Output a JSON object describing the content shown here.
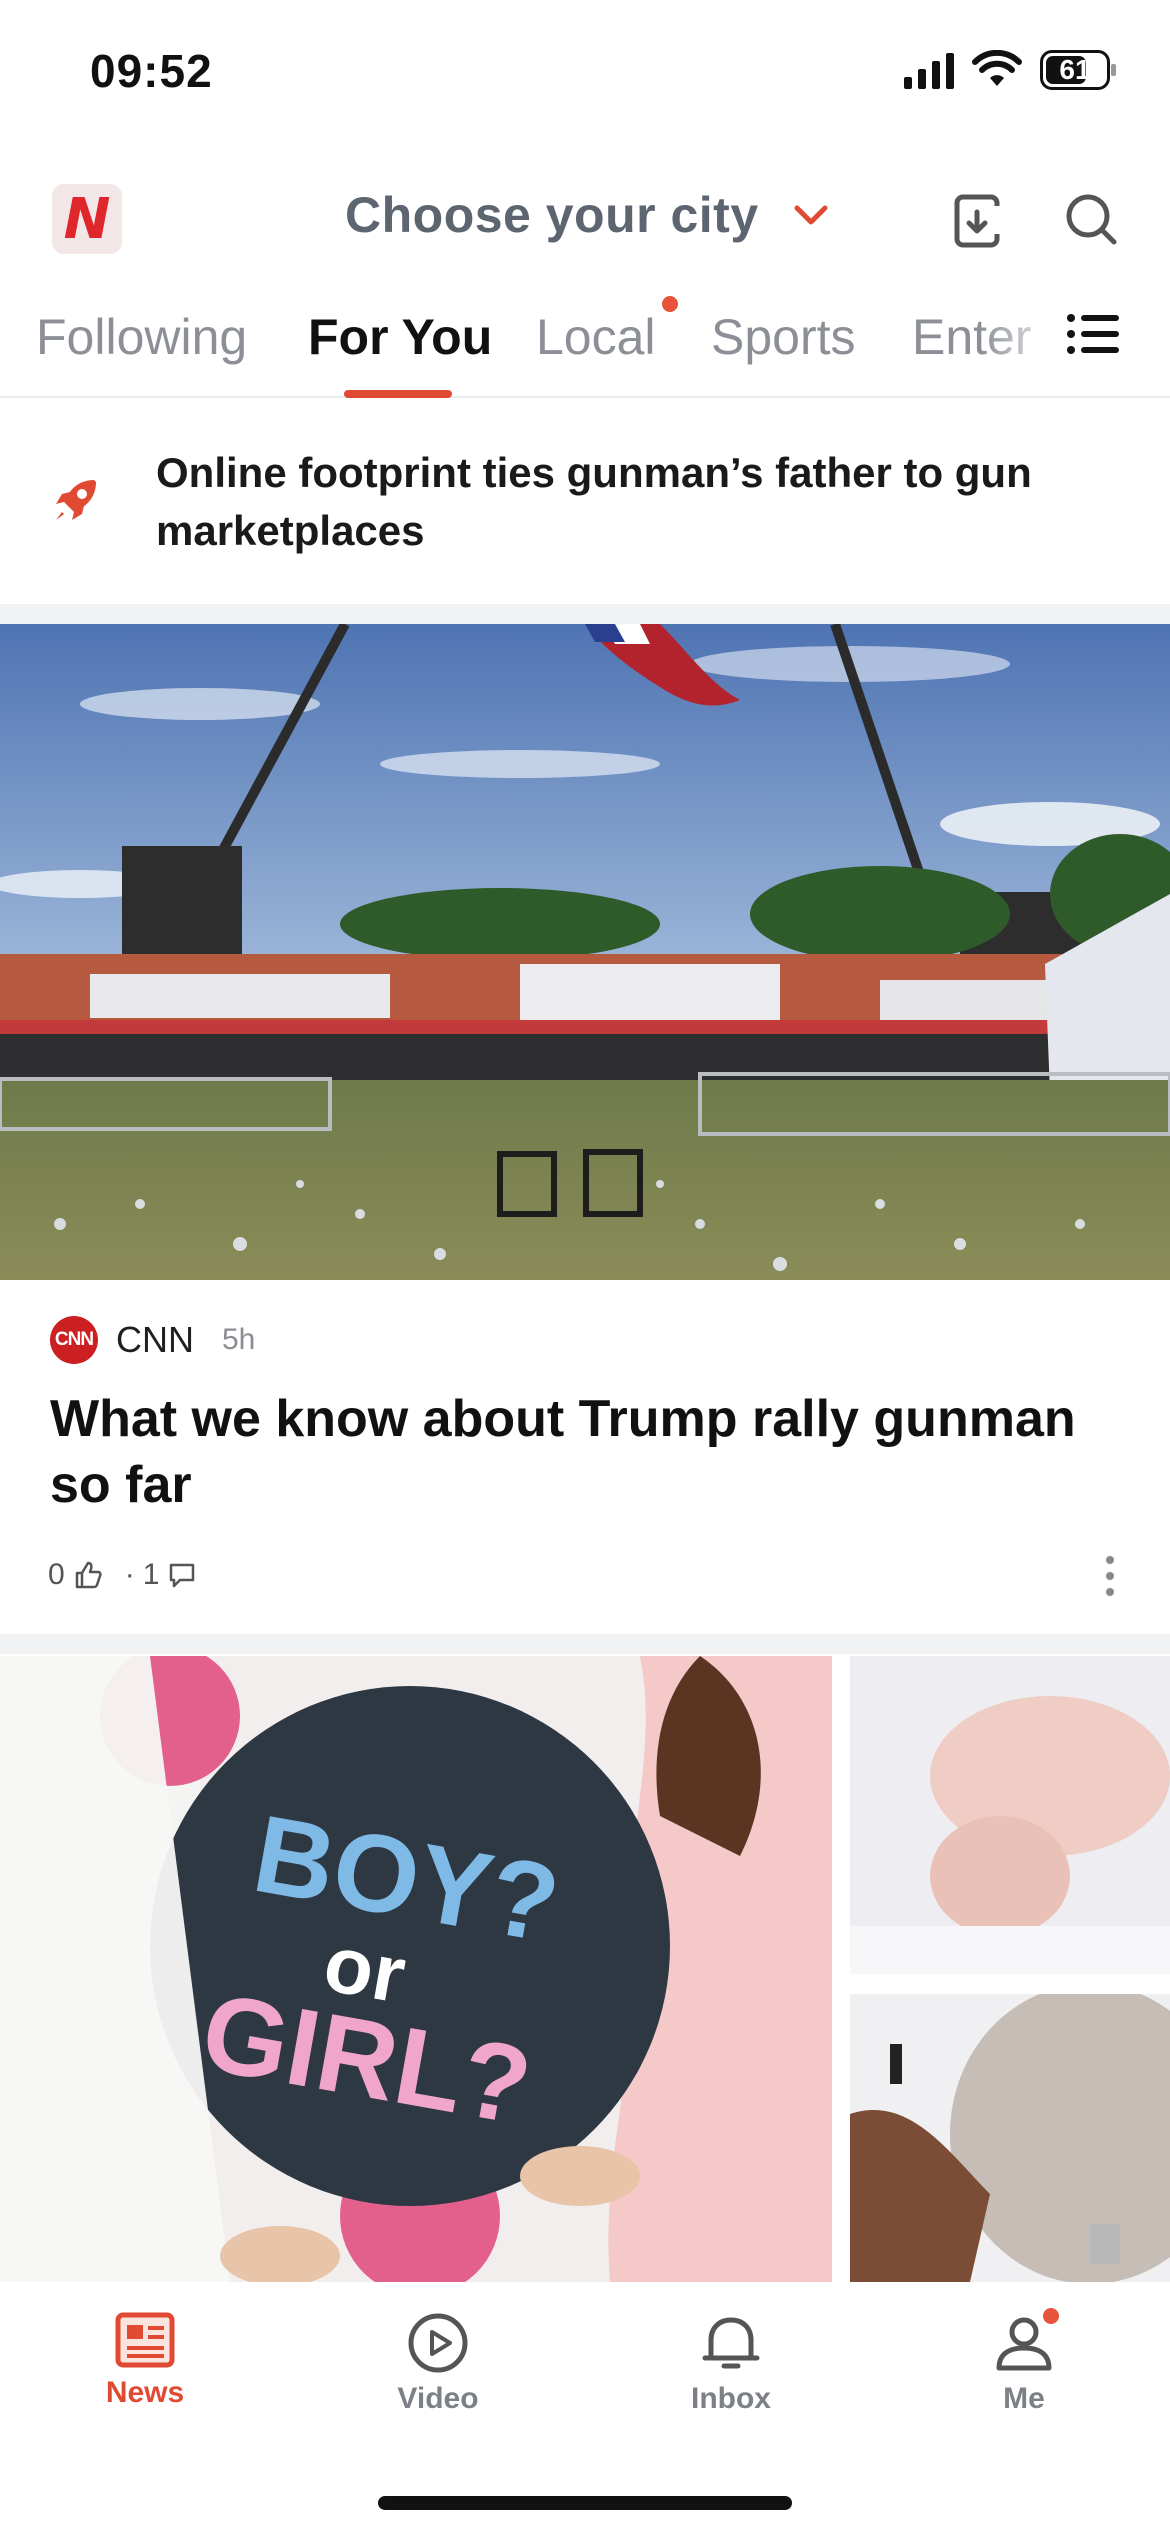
{
  "status_bar": {
    "time": "09:52",
    "battery": "61"
  },
  "header": {
    "city_label": "Choose your city"
  },
  "tabs": [
    {
      "label": "Following"
    },
    {
      "label": "For You"
    },
    {
      "label": "Local"
    },
    {
      "label": "Sports"
    },
    {
      "label": "Enter"
    }
  ],
  "trending": {
    "text": "Online footprint ties gunman’s father to gun marketplaces"
  },
  "article": {
    "source": "CNN",
    "source_logo_text": "CNN",
    "time": "5h",
    "headline": "What we know about Trump rally gunman so far",
    "likes": "0",
    "comments": "1"
  },
  "story2": {
    "balloon_line1": "BOY?",
    "balloon_line2": "or",
    "balloon_line3": "GIRL?"
  },
  "bottom_nav": [
    {
      "label": "News"
    },
    {
      "label": "Video"
    },
    {
      "label": "Inbox"
    },
    {
      "label": "Me"
    }
  ],
  "colors": {
    "accent": "#e04a33",
    "brand_red": "#e0262d",
    "cnn_red": "#cc1f22"
  }
}
